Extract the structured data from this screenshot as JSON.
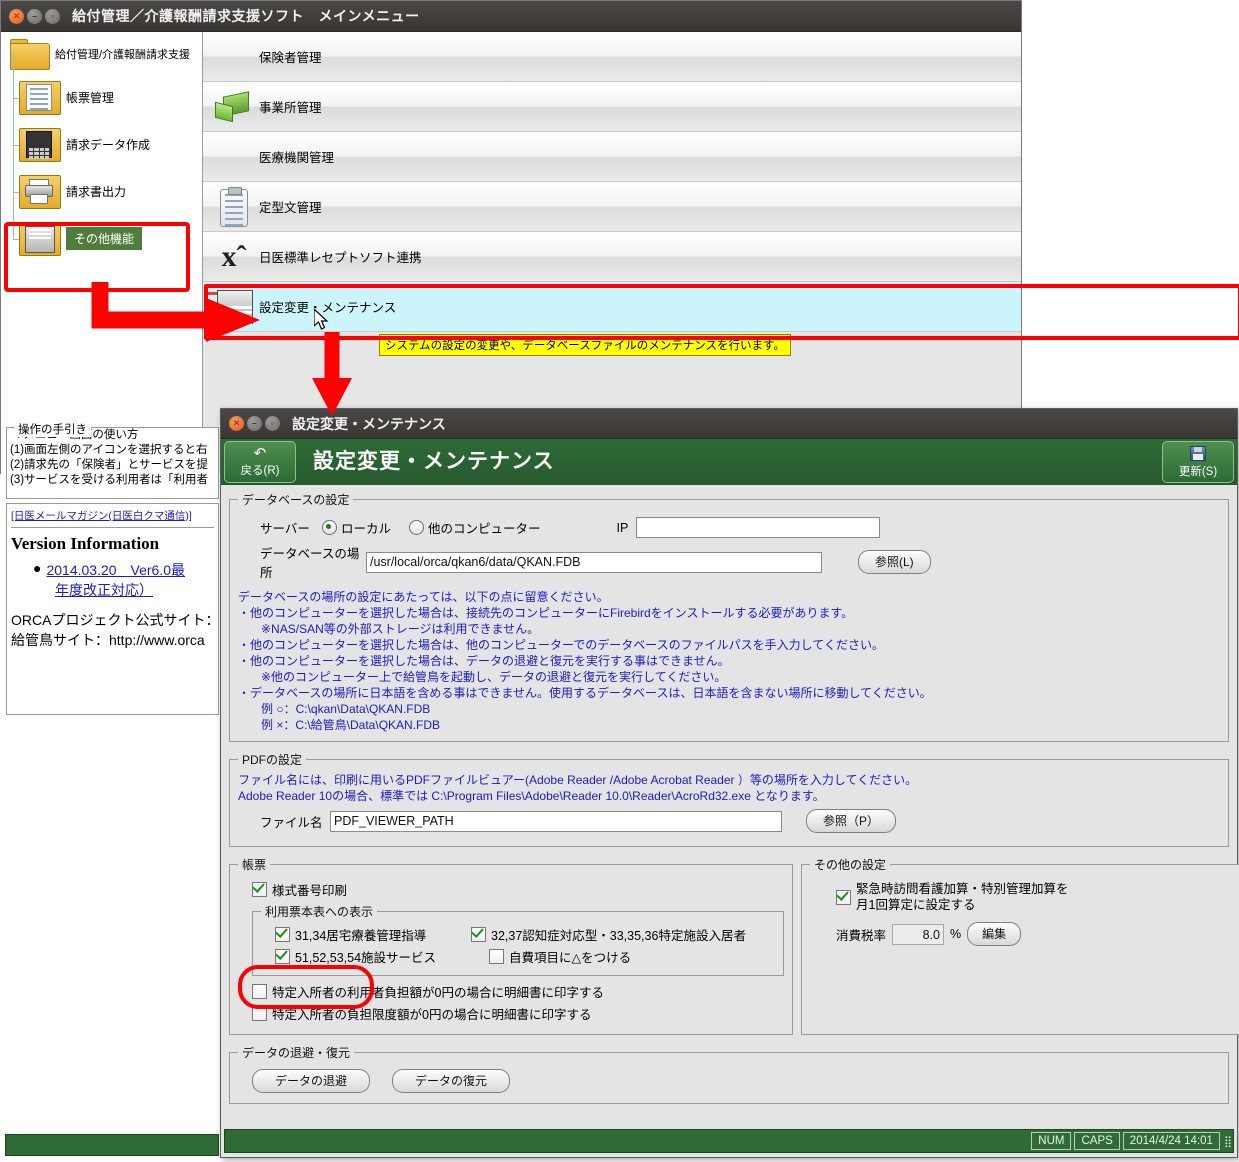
{
  "main_window": {
    "title": "給付管理／介護報酬請求支援ソフト　メインメニュー",
    "tree": {
      "root_label": "給付管理/介護報酬請求支援",
      "items": [
        {
          "label": "帳票管理",
          "icon": "document-folder-icon",
          "selected": false
        },
        {
          "label": "請求データ作成",
          "icon": "calculator-folder-icon",
          "selected": false
        },
        {
          "label": "請求書出力",
          "icon": "printer-folder-icon",
          "selected": false
        },
        {
          "label": "その他機能",
          "icon": "window-folder-icon",
          "selected": true
        }
      ]
    },
    "menu_rows": [
      {
        "label": "保険者管理",
        "icon": "building-icon",
        "selected": false
      },
      {
        "label": "事業所管理",
        "icon": "factory-icon",
        "selected": false
      },
      {
        "label": "医療機関管理",
        "icon": "hospital-icon",
        "selected": false
      },
      {
        "label": "定型文管理",
        "icon": "clipboard-icon",
        "selected": false
      },
      {
        "label": "日医標準レセプトソフト連携",
        "icon": "jma-logo-icon",
        "selected": false
      },
      {
        "label": "設定変更・メンテナンス",
        "icon": "settings-window-icon",
        "selected": true
      }
    ],
    "tooltip": "システムの設定の変更や、データベースファイルのメンテナンスを行います。",
    "guide": {
      "legend": "操作の手引き",
      "heading": "メニュー画面の使い方",
      "lines": [
        "(1)画面左側のアイコンを選択すると右",
        "(2)請求先の「保険者」とサービスを提",
        "(3)サービスを受ける利用者は「利用者"
      ]
    },
    "version": {
      "maillink": "[日医メールマガジン(日医白クマ通信)]",
      "title": "Version Information",
      "entry_line1": "2014.03.20　Ver6.0最",
      "entry_line2": "年度改正対応）",
      "site_line1": "ORCAプロジェクト公式サイト：",
      "site_line2": "給管鳥サイト：http://www.orca"
    }
  },
  "dialog": {
    "title": "設定変更・メンテナンス",
    "heading": "設定変更・メンテナンス",
    "toolbar": {
      "back_label": "戻る(R)",
      "update_label": "更新(S)"
    },
    "database": {
      "legend": "データベースの設定",
      "server_label": "サーバー",
      "radio_local": "ローカル",
      "radio_remote": "他のコンピューター",
      "radio_selected": "ローカル",
      "ip_label": "IP",
      "ip_value": "",
      "ip_placeholder": "",
      "path_label": "データベースの場所",
      "path_value": "/usr/local/orca/qkan6/data/QKAN.FDB",
      "browse_label": "参照(L)",
      "notes": [
        "データベースの場所の設定にあたっては、以下の点に留意ください。",
        "・他のコンピューターを選択した場合は、接続先のコンピューターにFirebirdをインストールする必要があります。",
        "　※NAS/SAN等の外部ストレージは利用できません。",
        "・他のコンピューターを選択した場合は、他のコンピューターでのデータベースのファイルパスを手入力してください。",
        "・他のコンピューターを選択した場合は、データの退避と復元を実行する事はできません。",
        "　※他のコンピューター上で給管鳥を起動し、データの退避と復元を実行してください。",
        "・データベースの場所に日本語を含める事はできません。使用するデータベースは、日本語を含まない場所に移動してください。",
        "　例 ○：C:\\qkan\\Data\\QKAN.FDB",
        "　例 ×：C:\\給管鳥\\Data\\QKAN.FDB"
      ]
    },
    "pdf": {
      "legend": "PDFの設定",
      "notes": [
        "ファイル名には、印刷に用いるPDFファイルビュアー(Adobe Reader /Adobe Acrobat Reader ）等の場所を入力してください。",
        "Adobe Reader 10の場合、標準では C:\\Program Files\\Adobe\\Reader 10.0\\Reader\\AcroRd32.exe となります。"
      ],
      "filename_label": "ファイル名",
      "filename_value": "PDF_VIEWER_PATH",
      "browse_label": "参照（P）"
    },
    "forms": {
      "legend": "帳票",
      "form_number_print": {
        "label": "様式番号印刷",
        "checked": true
      },
      "sub_legend": "利用票本表への表示",
      "sub_items": [
        {
          "label": "31,34居宅療養管理指導",
          "checked": true
        },
        {
          "label": "32,37認知症対応型・33,35,36特定施設入居者",
          "checked": true
        },
        {
          "label": "51,52,53,54施設サービス",
          "checked": true
        },
        {
          "label": "自費項目に△をつける",
          "checked": false
        }
      ],
      "extra_items": [
        {
          "label": "特定入所者の利用者負担額が0円の場合に明細書に印字する",
          "checked": false
        },
        {
          "label": "特定入所者の負担限度額が0円の場合に明細書に印字する",
          "checked": false
        }
      ]
    },
    "others": {
      "legend": "その他の設定",
      "emergency": {
        "line1": "緊急時訪問看護加算・特別管理加算を",
        "line2": "月1回算定に設定する",
        "checked": true
      },
      "tax_label": "消費税率",
      "tax_value": "8.0",
      "tax_unit": "%",
      "edit_label": "編集"
    },
    "backup": {
      "legend": "データの退避・復元",
      "evacuate_label": "データの退避",
      "restore_label": "データの復元"
    },
    "statusbar": {
      "num": "NUM",
      "caps": "CAPS",
      "datetime": "2014/4/24 14:01"
    }
  },
  "colors": {
    "accent_green": "#2f6b37",
    "annotation_red": "#ff0000",
    "selected_row": "#ccf5fb",
    "tooltip_yellow": "#ffff00",
    "link_blue": "#1a1ad1"
  }
}
